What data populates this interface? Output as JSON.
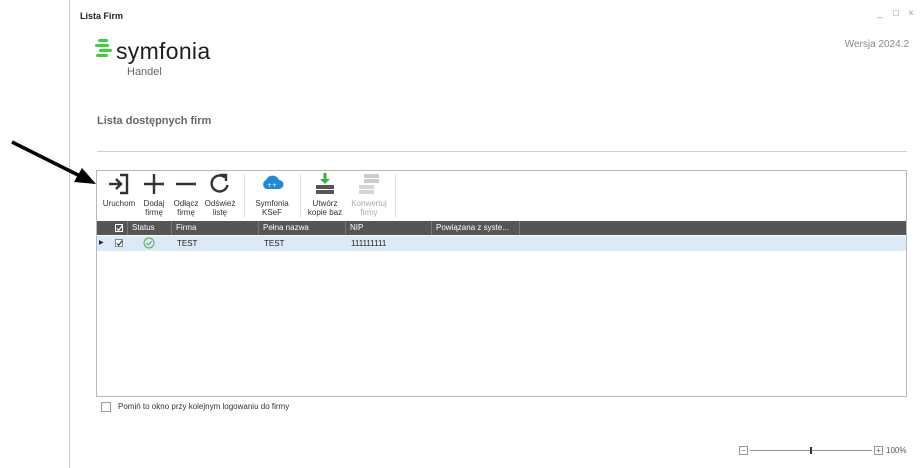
{
  "window": {
    "title": "Lista Firm",
    "controls": {
      "minimize": "_",
      "maximize": "□",
      "close": "×"
    },
    "version": "Wersja 2024.2"
  },
  "logo": {
    "word": "symfonia",
    "sub": "Handel",
    "brand_color": "#3ad23a"
  },
  "section_title": "Lista dostępnych firm",
  "toolbar": {
    "items": [
      {
        "id": "uruchom",
        "label": "Uruchom",
        "icon": "login-icon",
        "enabled": true
      },
      {
        "id": "dodaj",
        "label": "Dodaj\nfirmę",
        "icon": "plus-icon",
        "enabled": true
      },
      {
        "id": "odlacz",
        "label": "Odłącz\nfirmę",
        "icon": "minus-icon",
        "enabled": true
      },
      {
        "id": "odswiez",
        "label": "Odśwież\nlistę",
        "icon": "refresh-icon",
        "enabled": true
      },
      {
        "id": "ksef",
        "label": "Symfonia\nKSeF",
        "icon": "cloud-icon",
        "enabled": true
      },
      {
        "id": "kopia",
        "label": "Utwórz\nkopie baz",
        "icon": "backup-icon",
        "enabled": true
      },
      {
        "id": "konwertuj",
        "label": "Konwertuj\nfirmy",
        "icon": "convert-icon",
        "enabled": false
      }
    ]
  },
  "grid": {
    "columns": [
      "Status",
      "Firma",
      "Pełna nazwa",
      "NIP",
      "Powiązana z syste..."
    ],
    "rows": [
      {
        "checked": true,
        "status": "ok",
        "firma": "TEST",
        "pelna_nazwa": "TEST",
        "nip": "111111111",
        "powiazana": ""
      }
    ]
  },
  "footer": {
    "skip_label": "Pomiń to okno przy kolejnym logowaniu do firmy",
    "skip_checked": false,
    "zoom": {
      "minus": "−",
      "plus": "+",
      "value": "100%",
      "level": 0.5
    }
  },
  "colors": {
    "header_bg": "#555555",
    "row_selected": "#dce9f6",
    "status_ok": "#4caf50",
    "cloud": "#1e8ad6",
    "backup_arrow": "#3cb043"
  }
}
